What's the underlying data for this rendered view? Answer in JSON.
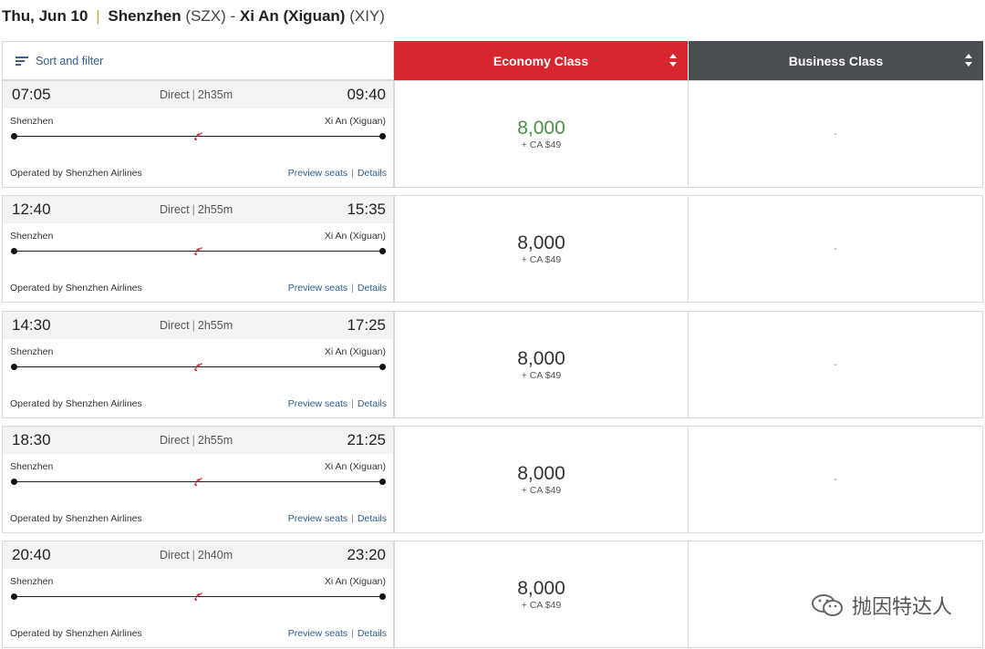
{
  "header": {
    "date": "Thu, Jun 10",
    "separator": "|",
    "origin_city": "Shenzhen",
    "origin_code": "(SZX)",
    "dash": "-",
    "dest_city": "Xi An (Xiguan)",
    "dest_code": "(XIY)"
  },
  "toolbar": {
    "sort_filter_label": "Sort and filter"
  },
  "columns": {
    "economy": "Economy Class",
    "business": "Business Class"
  },
  "colors": {
    "economy_header": "#d7262d",
    "business_header": "#4a4d52",
    "accent_link": "#2c5d8f",
    "price_highlight": "#4a8f4a",
    "plane_icon": "#d7262d"
  },
  "flights": [
    {
      "depart": "07:05",
      "arrive": "09:40",
      "type": "Direct",
      "duration": "2h35m",
      "from": "Shenzhen",
      "to": "Xi An (Xiguan)",
      "operator": "Operated by Shenzhen Airlines",
      "preview": "Preview seats",
      "details": "Details",
      "economy_miles": "8,000",
      "economy_tax": "+ CA $49",
      "business": "-"
    },
    {
      "depart": "12:40",
      "arrive": "15:35",
      "type": "Direct",
      "duration": "2h55m",
      "from": "Shenzhen",
      "to": "Xi An (Xiguan)",
      "operator": "Operated by Shenzhen Airlines",
      "preview": "Preview seats",
      "details": "Details",
      "economy_miles": "8,000",
      "economy_tax": "+ CA $49",
      "business": "-"
    },
    {
      "depart": "14:30",
      "arrive": "17:25",
      "type": "Direct",
      "duration": "2h55m",
      "from": "Shenzhen",
      "to": "Xi An (Xiguan)",
      "operator": "Operated by Shenzhen Airlines",
      "preview": "Preview seats",
      "details": "Details",
      "economy_miles": "8,000",
      "economy_tax": "+ CA $49",
      "business": "-"
    },
    {
      "depart": "18:30",
      "arrive": "21:25",
      "type": "Direct",
      "duration": "2h55m",
      "from": "Shenzhen",
      "to": "Xi An (Xiguan)",
      "operator": "Operated by Shenzhen Airlines",
      "preview": "Preview seats",
      "details": "Details",
      "economy_miles": "8,000",
      "economy_tax": "+ CA $49",
      "business": "-"
    },
    {
      "depart": "20:40",
      "arrive": "23:20",
      "type": "Direct",
      "duration": "2h40m",
      "from": "Shenzhen",
      "to": "Xi An (Xiguan)",
      "operator": "Operated by Shenzhen Airlines",
      "preview": "Preview seats",
      "details": "Details",
      "economy_miles": "8,000",
      "economy_tax": "+ CA $49",
      "business": ""
    }
  ],
  "watermark": {
    "text": "抛因特达人",
    "icon": "wechat-icon"
  }
}
